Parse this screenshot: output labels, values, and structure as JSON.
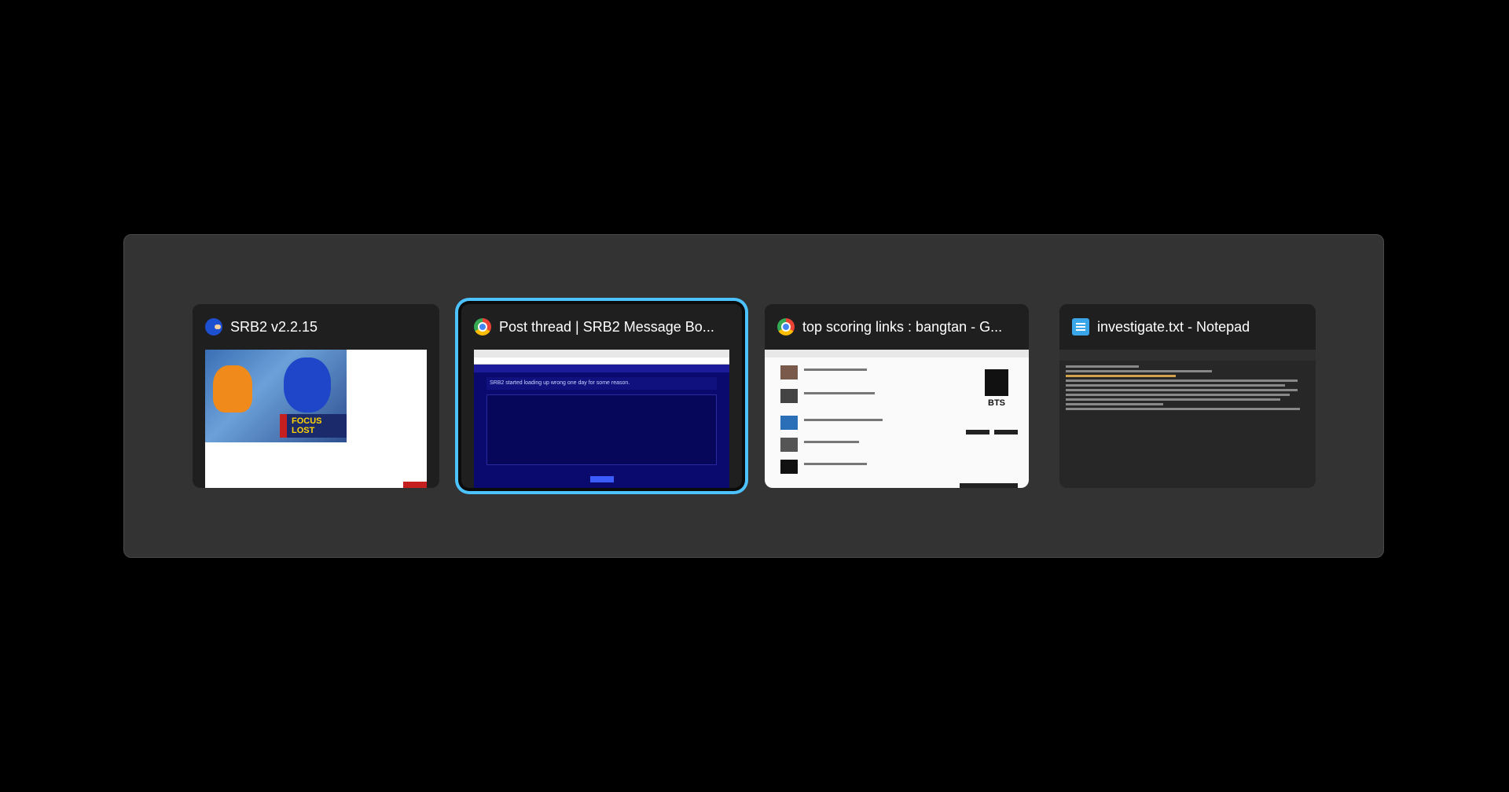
{
  "switcher": {
    "windows": [
      {
        "title": "SRB2 v2.2.15",
        "icon": "sonic-icon",
        "thumb_text": "FOCUS LOST"
      },
      {
        "title": "Post thread | SRB2 Message Bo...",
        "icon": "chrome-icon",
        "selected": true,
        "thumb_text": "SRB2 started loading up wrong one day for some reason."
      },
      {
        "title": "top scoring links : bangtan - G...",
        "icon": "chrome-icon",
        "thumb_text": "BTS"
      },
      {
        "title": "investigate.txt - Notepad",
        "icon": "notepad-icon"
      }
    ]
  },
  "colors": {
    "selection": "#4cc2ff",
    "panel": "#333333",
    "card": "#1f1f1f"
  }
}
